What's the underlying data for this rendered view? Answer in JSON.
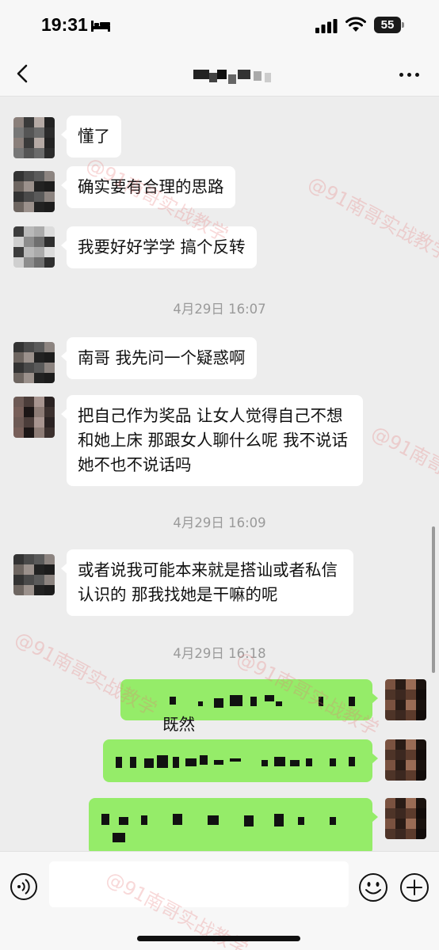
{
  "status_bar": {
    "time": "19:31",
    "battery": "55"
  },
  "nav": {
    "title": ""
  },
  "messages": [
    {
      "side": "left",
      "text": "懂了"
    },
    {
      "side": "left",
      "text": "确实要有合理的思路"
    },
    {
      "side": "left",
      "text": "我要好好学学 搞个反转"
    },
    {
      "timestamp": "4月29日 16:07"
    },
    {
      "side": "left",
      "text": "南哥 我先问一个疑惑啊"
    },
    {
      "side": "left",
      "text": "把自己作为奖品 让女人觉得自己不想和她上床 那跟女人聊什么呢 我不说话她不也不说话吗"
    },
    {
      "timestamp": "4月29日 16:09"
    },
    {
      "side": "left",
      "text": "或者说我可能本来就是搭讪或者私信认识的 那我找她是干嘛的呢"
    },
    {
      "timestamp": "4月29日 16:18"
    },
    {
      "side": "right",
      "text": "既然"
    },
    {
      "side": "right",
      "text": ""
    },
    {
      "side": "right",
      "text": ""
    }
  ],
  "input": {
    "placeholder": ""
  },
  "watermark": "@91南哥实战教学",
  "colors": {
    "my_bubble": "#95ec69",
    "their_bubble": "#ffffff",
    "background": "#ededed"
  },
  "icons": [
    "back-icon",
    "more-icon",
    "voice-icon",
    "emoji-icon",
    "plus-icon",
    "wifi-icon",
    "signal-icon",
    "bed-icon"
  ]
}
